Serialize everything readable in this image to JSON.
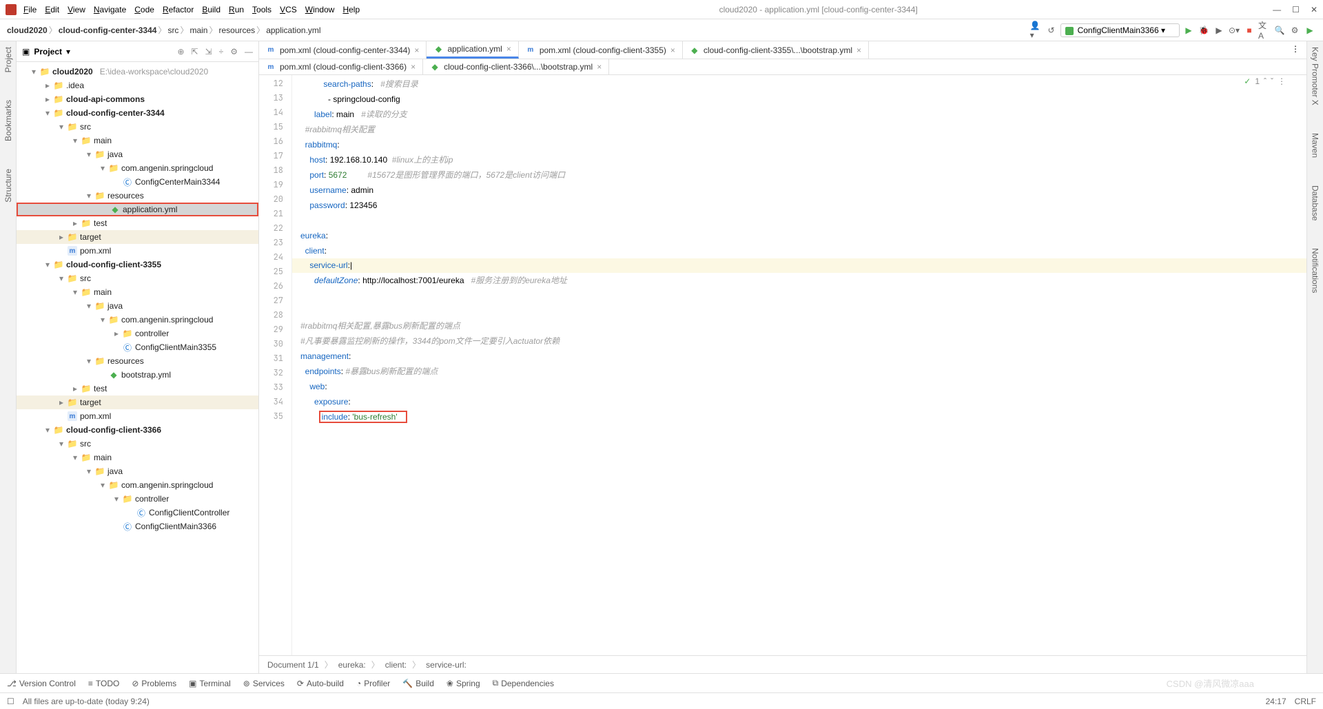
{
  "window": {
    "title": "cloud2020 - application.yml [cloud-config-center-3344]",
    "menus": [
      "File",
      "Edit",
      "View",
      "Navigate",
      "Code",
      "Refactor",
      "Build",
      "Run",
      "Tools",
      "VCS",
      "Window",
      "Help"
    ]
  },
  "breadcrumbs": [
    "cloud2020",
    "cloud-config-center-3344",
    "src",
    "main",
    "resources",
    "application.yml"
  ],
  "run_config": "ConfigClientMain3366",
  "project_header": "Project",
  "tree": [
    {
      "pad": 20,
      "chevron": "▾",
      "icon": "folder",
      "bold": true,
      "label": "cloud2020",
      "suffix": "E:\\idea-workspace\\cloud2020"
    },
    {
      "pad": 40,
      "chevron": "▸",
      "icon": "folder",
      "label": ".idea"
    },
    {
      "pad": 40,
      "chevron": "▸",
      "icon": "folder",
      "bold": true,
      "label": "cloud-api-commons"
    },
    {
      "pad": 40,
      "chevron": "▾",
      "icon": "folder",
      "bold": true,
      "label": "cloud-config-center-3344"
    },
    {
      "pad": 60,
      "chevron": "▾",
      "icon": "folder",
      "label": "src"
    },
    {
      "pad": 80,
      "chevron": "▾",
      "icon": "folder",
      "label": "main"
    },
    {
      "pad": 100,
      "chevron": "▾",
      "icon": "folder",
      "label": "java"
    },
    {
      "pad": 120,
      "chevron": "▾",
      "icon": "folder",
      "label": "com.angenin.springcloud"
    },
    {
      "pad": 140,
      "chevron": "",
      "icon": "class",
      "label": "ConfigCenterMain3344"
    },
    {
      "pad": 100,
      "chevron": "▾",
      "icon": "folder",
      "label": "resources"
    },
    {
      "pad": 120,
      "chevron": "",
      "icon": "yml",
      "label": "application.yml",
      "highlight": true
    },
    {
      "pad": 80,
      "chevron": "▸",
      "icon": "folder",
      "label": "test"
    },
    {
      "pad": 60,
      "chevron": "▸",
      "icon": "folder-orange",
      "label": "target",
      "yellowish": true
    },
    {
      "pad": 60,
      "chevron": "",
      "icon": "m",
      "label": "pom.xml"
    },
    {
      "pad": 40,
      "chevron": "▾",
      "icon": "folder",
      "bold": true,
      "label": "cloud-config-client-3355"
    },
    {
      "pad": 60,
      "chevron": "▾",
      "icon": "folder",
      "label": "src"
    },
    {
      "pad": 80,
      "chevron": "▾",
      "icon": "folder",
      "label": "main"
    },
    {
      "pad": 100,
      "chevron": "▾",
      "icon": "folder",
      "label": "java"
    },
    {
      "pad": 120,
      "chevron": "▾",
      "icon": "folder",
      "label": "com.angenin.springcloud"
    },
    {
      "pad": 140,
      "chevron": "▸",
      "icon": "folder",
      "label": "controller"
    },
    {
      "pad": 140,
      "chevron": "",
      "icon": "class",
      "label": "ConfigClientMain3355"
    },
    {
      "pad": 100,
      "chevron": "▾",
      "icon": "folder",
      "label": "resources"
    },
    {
      "pad": 120,
      "chevron": "",
      "icon": "yml",
      "label": "bootstrap.yml"
    },
    {
      "pad": 80,
      "chevron": "▸",
      "icon": "folder",
      "label": "test"
    },
    {
      "pad": 60,
      "chevron": "▸",
      "icon": "folder-orange",
      "label": "target",
      "yellowish": true
    },
    {
      "pad": 60,
      "chevron": "",
      "icon": "m",
      "label": "pom.xml"
    },
    {
      "pad": 40,
      "chevron": "▾",
      "icon": "folder",
      "bold": true,
      "label": "cloud-config-client-3366"
    },
    {
      "pad": 60,
      "chevron": "▾",
      "icon": "folder",
      "label": "src"
    },
    {
      "pad": 80,
      "chevron": "▾",
      "icon": "folder",
      "label": "main"
    },
    {
      "pad": 100,
      "chevron": "▾",
      "icon": "folder",
      "label": "java"
    },
    {
      "pad": 120,
      "chevron": "▾",
      "icon": "folder",
      "label": "com.angenin.springcloud"
    },
    {
      "pad": 140,
      "chevron": "▾",
      "icon": "folder",
      "label": "controller"
    },
    {
      "pad": 160,
      "chevron": "",
      "icon": "class",
      "label": "ConfigClientController"
    },
    {
      "pad": 140,
      "chevron": "",
      "icon": "class",
      "label": "ConfigClientMain3366"
    }
  ],
  "tabs_row1": [
    {
      "icon": "m",
      "label": "pom.xml (cloud-config-center-3344)"
    },
    {
      "icon": "yml",
      "label": "application.yml",
      "active": true
    },
    {
      "icon": "m",
      "label": "pom.xml (cloud-config-client-3355)"
    },
    {
      "icon": "yml",
      "label": "cloud-config-client-3355\\...\\bootstrap.yml"
    }
  ],
  "tabs_row2": [
    {
      "icon": "m",
      "label": "pom.xml (cloud-config-client-3366)"
    },
    {
      "icon": "yml",
      "label": "cloud-config-client-3366\\...\\bootstrap.yml"
    }
  ],
  "line_start": 12,
  "line_end": 35,
  "code_lines": [
    {
      "html": "          <span class='k-key'>search-paths</span>:   <span class='k-com'>#搜索目录</span>"
    },
    {
      "html": "            - springcloud-config"
    },
    {
      "html": "      <span class='k-key'>label</span>: main   <span class='k-com'>#读取的分支</span>"
    },
    {
      "html": "  <span class='k-com'>#rabbitmq相关配置</span>"
    },
    {
      "html": "  <span class='k-key'>rabbitmq</span>:"
    },
    {
      "html": "    <span class='k-key'>host</span>: 192.168.10.140  <span class='k-com'>#linux上的主机ip</span>"
    },
    {
      "html": "    <span class='k-key'>port</span>: <span class='k-num'>5672</span>         <span class='k-com'>#15672是图形管理界面的端口，5672是client访问端口</span>"
    },
    {
      "html": "    <span class='k-key'>username</span>: admin"
    },
    {
      "html": "    <span class='k-key'>password</span>: 123456"
    },
    {
      "html": ""
    },
    {
      "html": "<span class='k-key'>eureka</span>:"
    },
    {
      "html": "  <span class='k-key'>client</span>:"
    },
    {
      "html": "    <span class='k-key'>service-url</span>:<span class='cursor'>|</span>",
      "hl": true
    },
    {
      "html": "      <span class='k-ital'>defaultZone</span>: http://localhost:7001/eureka   <span class='k-com'>#服务注册到的eureka地址</span>"
    },
    {
      "html": ""
    },
    {
      "html": ""
    },
    {
      "html": "<span class='k-com'>#rabbitmq相关配置,暴露bus刷新配置的端点</span>"
    },
    {
      "html": "<span class='k-com'>#凡事要暴露监控刷新的操作，3344的pom文件一定要引入actuator依赖</span>"
    },
    {
      "html": "<span class='k-key'>management</span>:"
    },
    {
      "html": "  <span class='k-key'>endpoints</span>: <span class='k-com'>#暴露bus刷新配置的端点</span>"
    },
    {
      "html": "    <span class='k-key'>web</span>:"
    },
    {
      "html": "      <span class='k-key'>exposure</span>:"
    },
    {
      "html": "        <span class='red-box'><span class='k-key'>include</span>: <span class='k-str'>'bus-refresh'</span>&nbsp;&nbsp;&nbsp;</span>"
    },
    {
      "html": ""
    }
  ],
  "editor_crumb": [
    "Document 1/1",
    "eureka:",
    "client:",
    "service-url:"
  ],
  "inspection": "✓ 1",
  "bottom_tools": [
    "Version Control",
    "TODO",
    "Problems",
    "Terminal",
    "Services",
    "Auto-build",
    "Profiler",
    "Build",
    "Spring",
    "Dependencies"
  ],
  "status": {
    "msg": "All files are up-to-date (today 9:24)",
    "pos": "24:17",
    "lf": "CRLF",
    "watermark": "CSDN @清风微凉aaa"
  },
  "left_rail": [
    "Project",
    "Bookmarks",
    "Structure"
  ],
  "right_rail": [
    "Key Promoter X",
    "Maven",
    "Database",
    "Notifications"
  ]
}
